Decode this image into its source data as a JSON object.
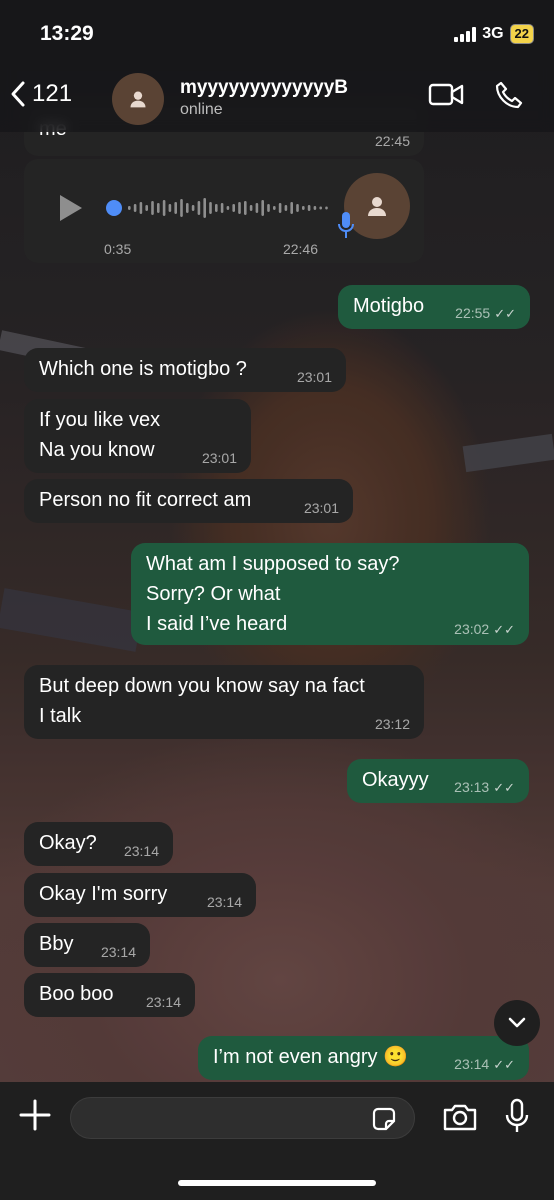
{
  "status": {
    "time": "13:29",
    "network": "3G",
    "battery": "22"
  },
  "header": {
    "back_count": "121",
    "contact_name": "myyyyyyyyyyyyyB",
    "contact_status": "online"
  },
  "messages": [
    {
      "dir": "in",
      "text": "me",
      "time": "22:45"
    },
    {
      "dir": "in",
      "type": "voice",
      "duration": "0:35",
      "time": "22:46"
    },
    {
      "dir": "out",
      "text": "Motigbo",
      "time": "22:55"
    },
    {
      "dir": "in",
      "text": "Which one is motigbo ?",
      "time": "23:01"
    },
    {
      "dir": "in",
      "lines": [
        "If you like vex",
        "Na you know"
      ],
      "time": "23:01"
    },
    {
      "dir": "in",
      "text": "Person no fit correct am",
      "time": "23:01"
    },
    {
      "dir": "out",
      "lines": [
        "What am I supposed to say?",
        "Sorry? Or what",
        "I said I’ve heard"
      ],
      "time": "23:02"
    },
    {
      "dir": "in",
      "lines": [
        "But deep down you know say na fact",
        "I talk"
      ],
      "time": "23:12"
    },
    {
      "dir": "out",
      "text": "Okayyy",
      "time": "23:13"
    },
    {
      "dir": "in",
      "text": "Okay?",
      "time": "23:14"
    },
    {
      "dir": "in",
      "text": "Okay I'm sorry",
      "time": "23:14"
    },
    {
      "dir": "in",
      "text": "Bby",
      "time": "23:14"
    },
    {
      "dir": "in",
      "text": "Boo boo",
      "time": "23:14"
    },
    {
      "dir": "out",
      "text": "I’m not even angry 🙂",
      "time": "23:14"
    }
  ],
  "input": {
    "value": "",
    "placeholder": ""
  },
  "colors": {
    "incoming": "#242424",
    "outgoing": "#1f5a3e"
  }
}
